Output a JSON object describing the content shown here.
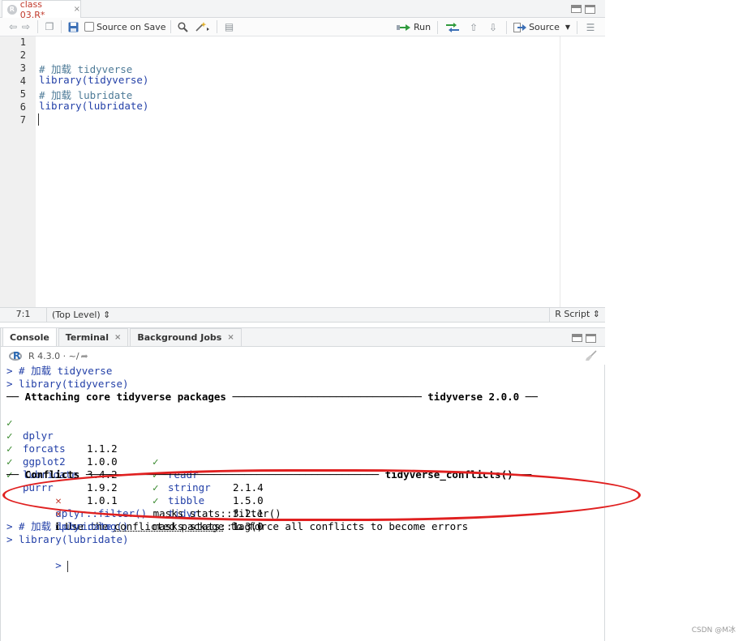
{
  "editor": {
    "tab_title": "class 03.R*",
    "tab_close": "×",
    "source_on_save_label": "Source on Save",
    "run_label": "Run",
    "source_label": "Source",
    "line_numbers": [
      "1",
      "2",
      "3",
      "4",
      "5",
      "6",
      "7"
    ],
    "lines": [
      {
        "text": "",
        "kind": "plain"
      },
      {
        "text": "",
        "kind": "plain"
      },
      {
        "text": "# 加载 tidyverse",
        "kind": "comment"
      },
      {
        "text": "library(tidyverse)",
        "kind": "code"
      },
      {
        "text": "# 加载 lubridate",
        "kind": "comment"
      },
      {
        "text": "library(lubridate)",
        "kind": "code"
      },
      {
        "text": "",
        "kind": "plain"
      }
    ],
    "status": {
      "cursor_pos": "7:1",
      "scope": "(Top Level) ⇕",
      "file_type": "R Script ⇕"
    }
  },
  "console": {
    "tabs": [
      {
        "label": "Console",
        "closable": false
      },
      {
        "label": "Terminal",
        "closable": true
      },
      {
        "label": "Background Jobs",
        "closable": true
      }
    ],
    "r_version": "R 4.3.0 · ~/",
    "lines": {
      "l1": "> # 加载 tidyverse",
      "l2": "> library(tidyverse)",
      "attaching": "── Attaching core tidyverse packages ─────────────────────────────── tidyverse 2.0.0 ──",
      "conflicts_header": "── Conflicts ──────────────────────────────────────────────── tidyverse_conflicts() ──",
      "conflict1_pkg": "dplyr::filter()",
      "conflict1_rest": " masks stats::filter()",
      "conflict2_pkg": "dplyr::lag()",
      "conflict2_rest": "    masks stats::lag()",
      "info_prefix": "ℹ Use the ",
      "info_link": "conflicted package",
      "info_suffix": " to force all conflicts to become errors",
      "l_after1": "> # 加载 lubridate",
      "l_after2": "> library(lubridate)",
      "prompt": "> "
    },
    "packages": [
      {
        "name": "dplyr",
        "version": "1.1.2"
      },
      {
        "name": "forcats",
        "version": "1.0.0"
      },
      {
        "name": "ggplot2",
        "version": "3.4.2"
      },
      {
        "name": "lubridate",
        "version": "1.9.2"
      },
      {
        "name": "purrr",
        "version": "1.0.1"
      },
      {
        "name": "readr",
        "version": "2.1.4"
      },
      {
        "name": "stringr",
        "version": "1.5.0"
      },
      {
        "name": "tibble",
        "version": "3.2.1"
      },
      {
        "name": "tidyr",
        "version": "1.3.0"
      }
    ],
    "check_mark": "✓",
    "cross_mark": "✕"
  },
  "watermark": "CSDN @M冰",
  "colors": {
    "comment": "#4d7a97",
    "keyword": "#2441a8",
    "check": "#3a8a2f",
    "conflict": "#c0392b",
    "annotation_ellipse": "#e02020"
  }
}
